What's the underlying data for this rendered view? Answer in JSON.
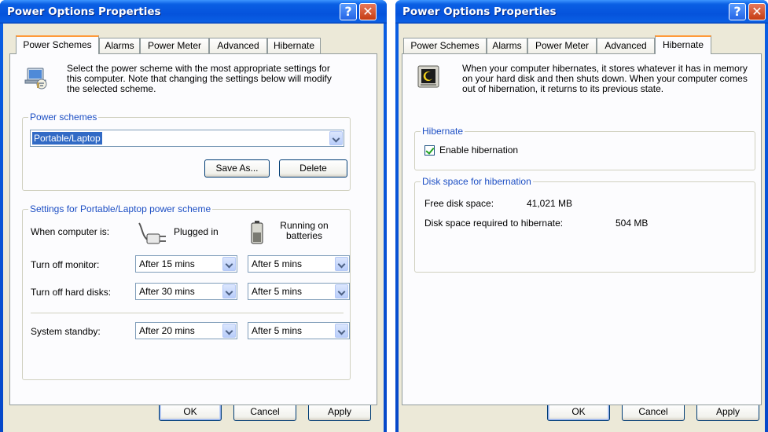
{
  "windows": [
    {
      "title": "Power Options Properties",
      "tabs": [
        "Power Schemes",
        "Alarms",
        "Power Meter",
        "Advanced",
        "Hibernate"
      ],
      "active_tab": "Power Schemes",
      "intro_text": "Select the power scheme with the most appropriate settings for this computer. Note that changing the settings below will modify the selected scheme.",
      "schemes_group": {
        "legend": "Power schemes",
        "selected": "Portable/Laptop",
        "save_as": "Save As...",
        "delete": "Delete"
      },
      "settings_group": {
        "legend": "Settings for Portable/Laptop power scheme",
        "when_label": "When computer is:",
        "plugged_label": "Plugged in",
        "battery_label": "Running on batteries",
        "rows": [
          {
            "label": "Turn off monitor:",
            "plugged": "After 15 mins",
            "battery": "After 5 mins"
          },
          {
            "label": "Turn off hard disks:",
            "plugged": "After 30 mins",
            "battery": "After 5 mins"
          },
          {
            "label": "System standby:",
            "plugged": "After 20 mins",
            "battery": "After 5 mins"
          }
        ]
      },
      "buttons": {
        "ok": "OK",
        "cancel": "Cancel",
        "apply": "Apply"
      }
    },
    {
      "title": "Power Options Properties",
      "tabs": [
        "Power Schemes",
        "Alarms",
        "Power Meter",
        "Advanced",
        "Hibernate"
      ],
      "active_tab": "Hibernate",
      "intro_text": "When your computer hibernates, it stores whatever it has in memory on your hard disk and then shuts down. When your computer comes out of hibernation, it returns to its previous state.",
      "hibernate_group": {
        "legend": "Hibernate",
        "enable_label": "Enable hibernation",
        "enabled": true
      },
      "disk_group": {
        "legend": "Disk space for hibernation",
        "free_label": "Free disk space:",
        "free_value": "41,021 MB",
        "required_label": "Disk space required to hibernate:",
        "required_value": "504 MB"
      },
      "buttons": {
        "ok": "OK",
        "cancel": "Cancel",
        "apply": "Apply"
      }
    }
  ],
  "title_buttons": {
    "help": "?",
    "close": "✕"
  },
  "colors": {
    "title_blue": "#0a5fe4",
    "dialog_bg": "#ece9d8",
    "tab_accent": "#ff9a3a",
    "group_label": "#1d4fc4"
  }
}
